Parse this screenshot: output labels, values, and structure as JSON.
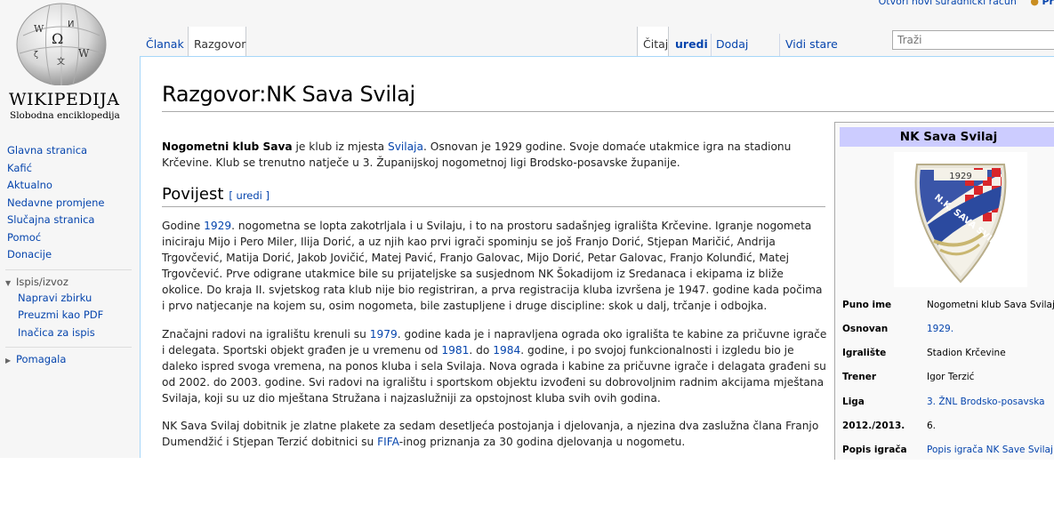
{
  "logo": {
    "wordmark": "WIKIPEDIJA",
    "tagline": "Slobodna enciklopedija"
  },
  "personal": {
    "create_account": "Otvori novi suradnički račun",
    "login": "Pr"
  },
  "tabs": {
    "left": [
      "Članak",
      "Razgovor"
    ],
    "right": [
      "Čitaj",
      "uredi",
      "Dodaj temu",
      "Vidi stare izmjene"
    ]
  },
  "search": {
    "placeholder": "Traži"
  },
  "sidebar": {
    "items": [
      "Glavna stranica",
      "Kafić",
      "Aktualno",
      "Nedavne promjene",
      "Slučajna stranica",
      "Pomoć",
      "Donacije"
    ],
    "print_head": "Ispis/izvoz",
    "print_items": [
      "Napravi zbirku",
      "Preuzmi kao PDF",
      "Inačica za ispis"
    ],
    "tools_head": "Pomagala"
  },
  "page": {
    "title": "Razgovor:NK Sava Svilaj",
    "intro_bold": "Nogometni klub Sava",
    "intro_a": " je klub iz mjesta ",
    "intro_link": "Svilaja",
    "intro_b": ". Osnovan je 1929 godine. Svoje domaće utakmice igra na stadionu Krčevine. Klub se trenutno natječe u 3. Županijskoj nogometnoj ligi Brodsko-posavske županije.",
    "h2": "Povijest",
    "edit_label": "[ uredi ]",
    "p1_a": "Godine ",
    "p1_link": "1929",
    "p1_b": ". nogometna se lopta zakotrljala i u Svilaju, i to na prostoru sadašnjeg igrališta Krčevine. Igranje nogometa iniciraju Mijo i Pero Miler, Ilija Dorić, a uz njih kao prvi igrači spominju se još Franjo Dorić, Stjepan Maričić, Andrija Trgovčević, Matija Dorić, Jakob Jovičić, Matej Pavić, Franjo Galovac, Mijo Dorić, Petar Galovac, Franjo Kolunđić, Matej Trgovčević. Prve odigrane utakmice bile su prijateljske sa susjednom NK Šokadijom iz Sredanaca i ekipama iz bliže okolice. Do kraja II. svjetskog rata klub nije bio registriran, a prva registracija kluba izvršena je 1947. godine kada počima i prvo natjecanje na kojem su, osim nogometa, bile zastupljene i druge discipline: skok u dalj, trčanje i odbojka.",
    "p2_a": "Značajni radovi na igralištu krenuli su ",
    "p2_link1": "1979",
    "p2_b": ". godine kada je i napravljena ograda oko igrališta te kabine za pričuvne igrače i delegata. Sportski objekt građen je u vremenu od ",
    "p2_link2": "1981",
    "p2_c": ". do ",
    "p2_link3": "1984",
    "p2_d": ". godine, i po svojoj funkcionalnosti i izgledu bio je daleko ispred svoga vremena, na ponos kluba i sela Svilaja. Nova ograda i kabine za pričuvne igrače i delagata građeni su od 2002. do 2003. godine. Svi radovi na igralištu i sportskom objektu izvođeni su dobrovoljnim radnim akcijama mještana Svilaja, koji su uz dio mještana Stružana i najzaslužniji za opstojnost kluba svih ovih godina.",
    "p3_a": "NK Sava Svilaj dobitnik je zlatne plakete za sedam desetljeća postojanja i djelovanja, a njezina dva zaslužna člana Franjo Dumendžić i Stjepan Terzić dobitnici su ",
    "p3_link": "FIFA",
    "p3_b": "-inog priznanja za 30 godina djelovanja u nogometu."
  },
  "infobox": {
    "title": "NK Sava Svilaj",
    "crest": {
      "year": "1929",
      "text": "N.K. SAVA SVILAJ"
    },
    "rows": [
      {
        "label": "Puno ime",
        "value": "Nogometni klub Sava Svilaj",
        "link": false
      },
      {
        "label": "Osnovan",
        "value": "1929.",
        "link": true
      },
      {
        "label": "Igralište",
        "value": "Stadion Krčevine",
        "link": false
      },
      {
        "label": "Trener",
        "value": "Igor Terzić",
        "link": false
      },
      {
        "label": "Liga",
        "value": "3. ŽNL Brodsko-posavska",
        "link": true
      },
      {
        "label": "2012./2013.",
        "value": "6.",
        "link": false
      },
      {
        "label": "Popis igrača",
        "value": "Popis igrača NK Save Svilaj",
        "link": true
      }
    ]
  }
}
